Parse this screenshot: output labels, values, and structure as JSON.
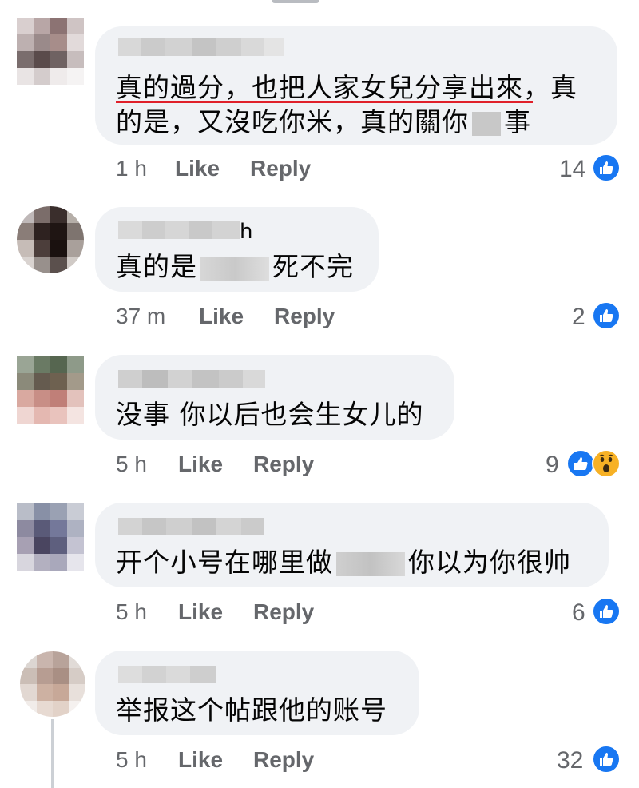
{
  "colors": {
    "bubble": "#f0f2f5",
    "meta": "#65676b",
    "like_blue": "#1877f2",
    "wow_yellow": "#f7b125",
    "underline_red": "#e0202a"
  },
  "actions": {
    "like": "Like",
    "reply": "Reply"
  },
  "comments": [
    {
      "line1": "真的過分，也把人家女兒分享出來，真",
      "line2_before": "的是，又沒吃你米，真的關你",
      "line2_after": "事",
      "time": "1 h",
      "reactions": "14",
      "reaction_icons": [
        "like-icon"
      ]
    },
    {
      "text_before": "真的是",
      "text_after": "死不完",
      "name_tail": "h",
      "time": "37 m",
      "reactions": "2",
      "reaction_icons": [
        "like-icon"
      ]
    },
    {
      "text": "没事 你以后也会生女儿的",
      "time": "5 h",
      "reactions": "9",
      "reaction_icons": [
        "like-icon",
        "wow-icon"
      ]
    },
    {
      "text_before": "开个小号在哪里做",
      "text_after": "你以为你很帅",
      "time": "5 h",
      "reactions": "6",
      "reaction_icons": [
        "like-icon"
      ]
    },
    {
      "text": "举报这个帖跟他的账号",
      "time": "5 h",
      "reactions": "32",
      "reaction_icons": [
        "like-icon"
      ]
    }
  ]
}
